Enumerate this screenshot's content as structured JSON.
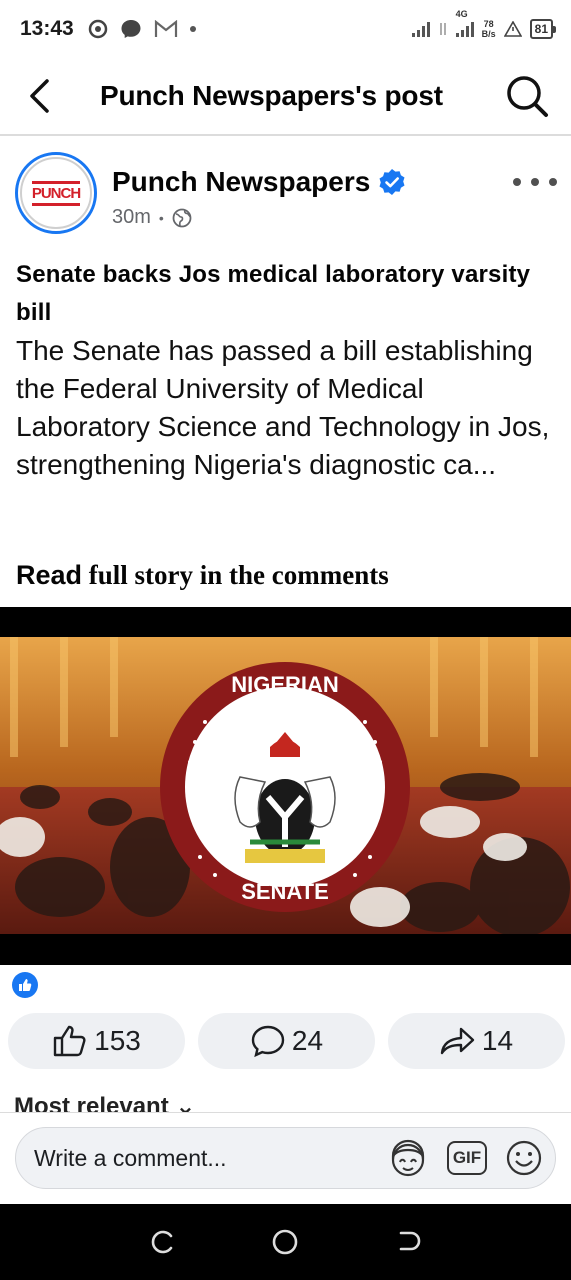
{
  "status_bar": {
    "time": "13:43",
    "network": "4G",
    "rate_value": "78",
    "rate_unit": "B/s",
    "battery": "81"
  },
  "header": {
    "title": "Punch Newspapers's post"
  },
  "post": {
    "page_name": "Punch Newspapers",
    "avatar_text": "PUNCH",
    "time_ago": "30m",
    "separator": "•",
    "headline": "Senate backs Jos medical laboratory varsity bill",
    "body": " The Senate has passed a bill establishing the Federal University of Medical Laboratory Science and Technology in Jos, strengthening Nigeria's diagnostic ca...",
    "read_more_a": "Read",
    "read_more_b": " full story in the comments",
    "image_seal_top": "NIGERIAN",
    "image_seal_bottom": "SENATE"
  },
  "actions": {
    "likes": "153",
    "comments": "24",
    "shares": "14"
  },
  "comments_section": {
    "sort_label": "Most relevant",
    "placeholder": "Write a comment...",
    "gif_label": "GIF"
  },
  "colors": {
    "accent": "#1877f2",
    "brand_red": "#d3202a",
    "senate_red": "#8b1a1a"
  }
}
